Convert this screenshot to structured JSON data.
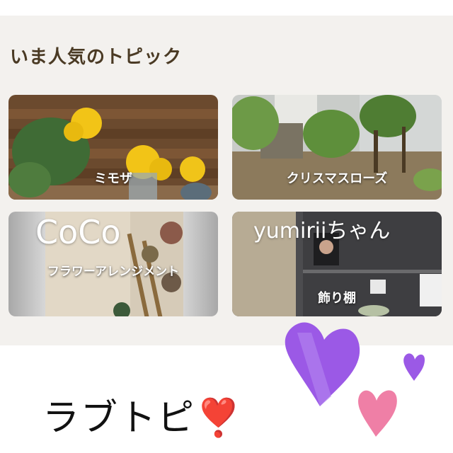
{
  "section_title": "いま人気のトピック",
  "cards": [
    {
      "label": "ミモザ"
    },
    {
      "label": "クリスマスローズ"
    },
    {
      "label": "フラワーアレンジメント",
      "overlay_text": "CoCo"
    },
    {
      "label": "飾り棚",
      "overlay_text": "yumiriiちゃん"
    }
  ],
  "caption": "ラブトピ❣️",
  "colors": {
    "panel_bg": "#f3f1ee",
    "title": "#4a3a24",
    "heart_purple": "#9b59e6",
    "heart_pink": "#ef7fa6"
  }
}
